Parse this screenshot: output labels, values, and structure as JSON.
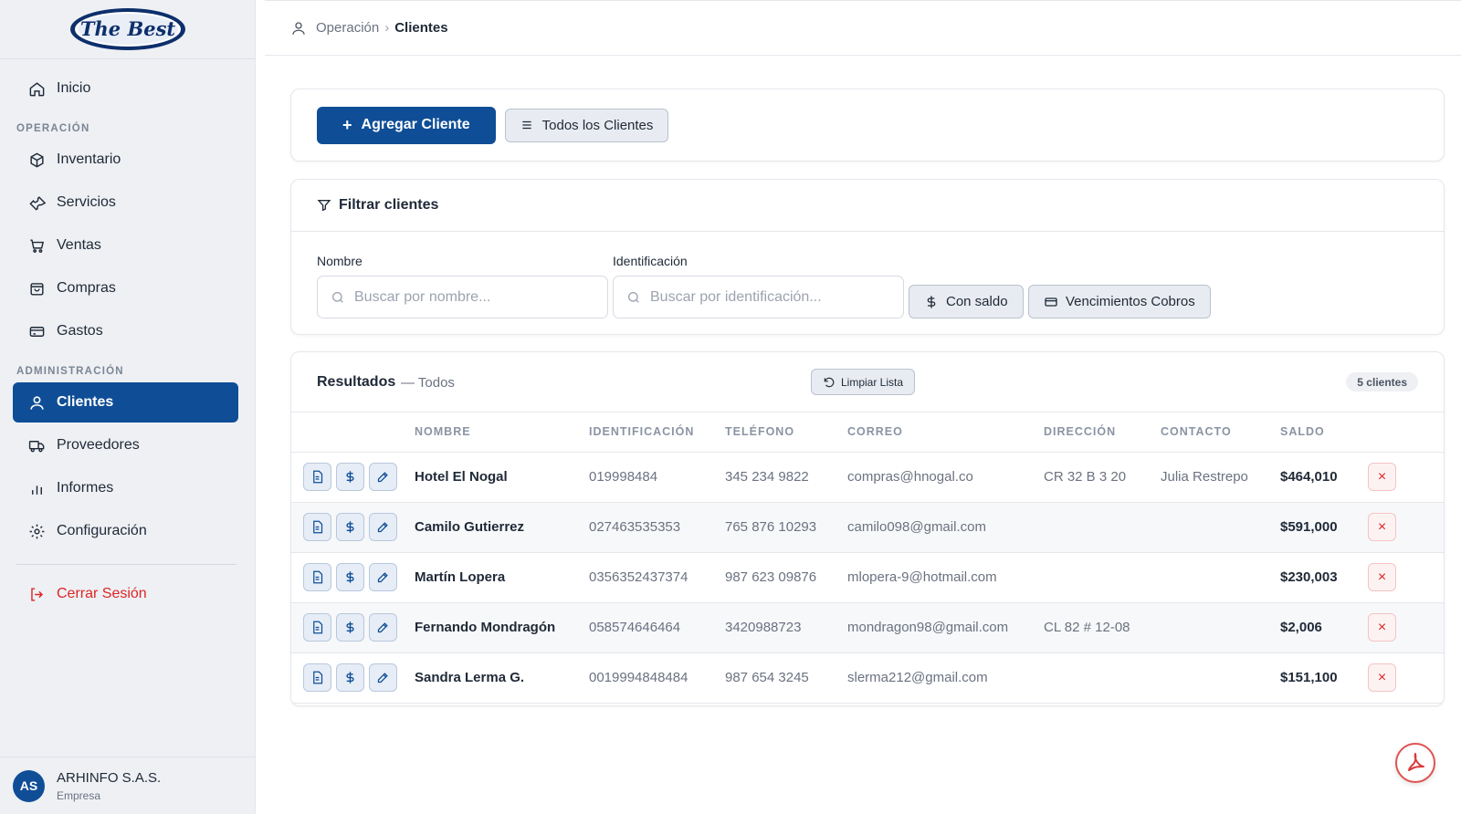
{
  "brand": {
    "logo_text": "The Best"
  },
  "sidebar": {
    "home": "Inicio",
    "sections": [
      {
        "title": "OPERACIÓN",
        "items": [
          "Inventario",
          "Servicios",
          "Ventas",
          "Compras",
          "Gastos"
        ]
      },
      {
        "title": "ADMINISTRACIÓN",
        "items": [
          "Clientes",
          "Proveedores",
          "Informes",
          "Configuración"
        ]
      }
    ],
    "active_item": "Clientes",
    "logout": "Cerrar Sesión"
  },
  "user": {
    "initials": "AS",
    "name": "ARHINFO S.A.S.",
    "role": "Empresa"
  },
  "breadcrumb": {
    "parent": "Operación",
    "separator": "›",
    "current": "Clientes"
  },
  "actions": {
    "add_label": "Agregar Cliente",
    "add_icon": "+",
    "all_label": "Todos los Clientes"
  },
  "filter": {
    "title": "Filtrar clientes",
    "name_label": "Nombre",
    "name_placeholder": "Buscar por nombre...",
    "id_label": "Identificación",
    "id_placeholder": "Buscar por identificación...",
    "with_balance": "Con saldo",
    "due_dates": "Vencimientos Cobros"
  },
  "results": {
    "title": "Resultados",
    "subtitle": "— Todos",
    "clear_label": "Limpiar Lista",
    "count": "5 clientes",
    "columns": [
      "NOMBRE",
      "IDENTIFICACIÓN",
      "TELÉFONO",
      "CORREO",
      "DIRECCIÓN",
      "CONTACTO",
      "SALDO"
    ],
    "rows": [
      {
        "nombre": "Hotel El Nogal",
        "identificacion": "019998484",
        "telefono": "345 234 9822",
        "correo": "compras@hnogal.co",
        "direccion": "CR 32 B 3 20",
        "contacto": "Julia Restrepo",
        "saldo": "$464,010"
      },
      {
        "nombre": "Camilo Gutierrez",
        "identificacion": "027463535353",
        "telefono": "765 876 10293",
        "correo": "camilo098@gmail.com",
        "direccion": "",
        "contacto": "",
        "saldo": "$591,000"
      },
      {
        "nombre": "Martín Lopera",
        "identificacion": "0356352437374",
        "telefono": "987 623 09876",
        "correo": "mlopera-9@hotmail.com",
        "direccion": "",
        "contacto": "",
        "saldo": "$230,003"
      },
      {
        "nombre": "Fernando Mondragón",
        "identificacion": "058574646464",
        "telefono": "3420988723",
        "correo": "mondragon98@gmail.com",
        "direccion": "CL 82 # 12-08",
        "contacto": "",
        "saldo": "$2,006"
      },
      {
        "nombre": "Sandra Lerma G.",
        "identificacion": "0019994848484",
        "telefono": "987 654 3245",
        "correo": "slerma212@gmail.com",
        "direccion": "",
        "contacto": "",
        "saldo": "$151,100"
      }
    ],
    "delete_icon": "×"
  },
  "icons": {
    "home": "home-icon",
    "inventory": "box-icon",
    "services": "wrench-icon",
    "sales": "cart-icon",
    "purchases": "bag-icon",
    "expenses": "wallet-icon",
    "clients": "user-icon",
    "suppliers": "truck-icon",
    "reports": "bar-chart-icon",
    "settings": "gear-icon",
    "logout": "logout-icon",
    "pdf": "pdf-icon"
  },
  "colors": {
    "primary": "#0f4e96",
    "danger": "#dc2626",
    "sidebar_bg": "#eef0f4"
  }
}
